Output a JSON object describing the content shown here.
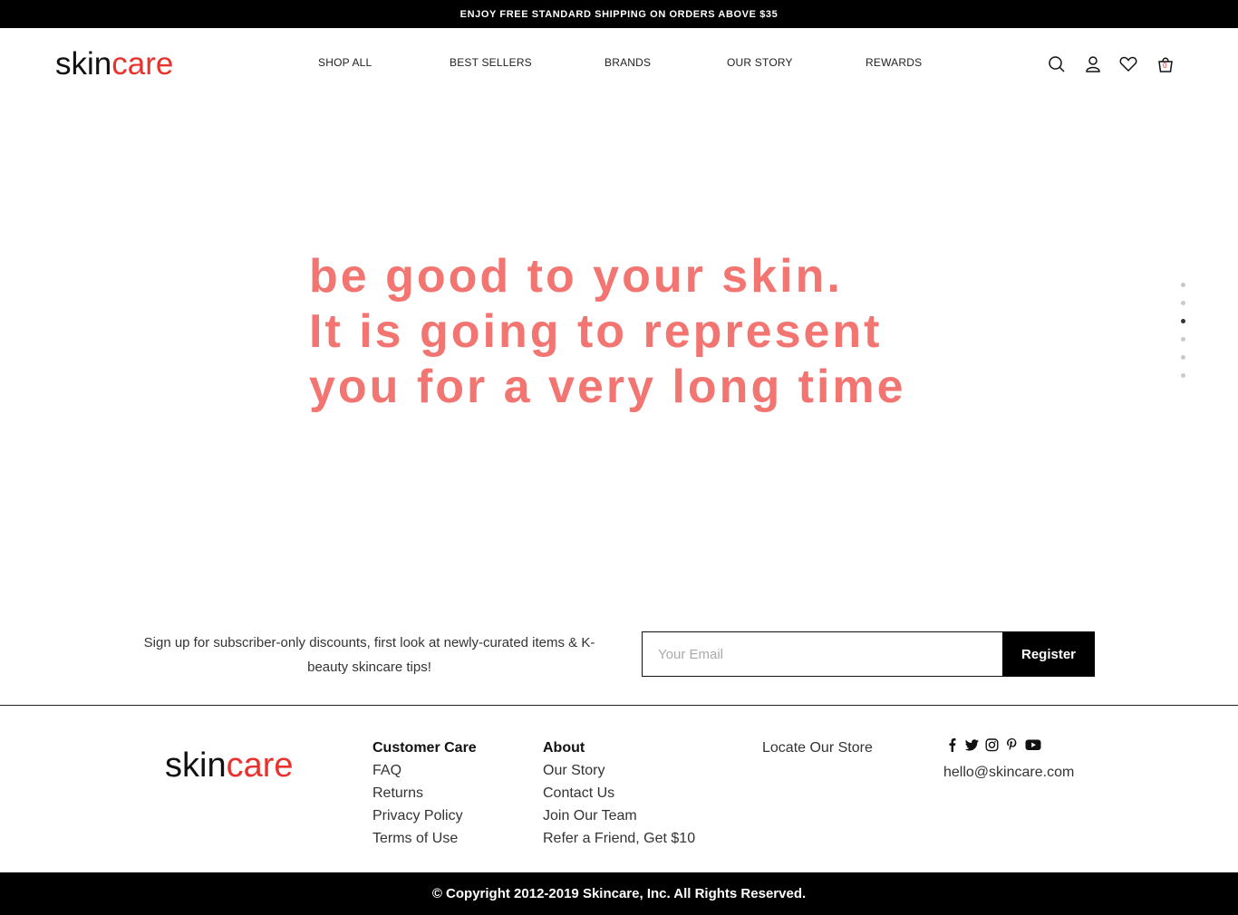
{
  "announcement": "ENJOY FREE STANDARD SHIPPING ON ORDERS ABOVE $35",
  "logo": {
    "part1": "skin",
    "part2": "care",
    "accent_color": "#e8322e"
  },
  "nav": [
    "SHOP ALL",
    "BEST SELLERS",
    "BRANDS",
    "OUR STORY",
    "REWARDS"
  ],
  "header_icons": [
    "search-icon",
    "user-icon",
    "heart-icon",
    "cart-icon"
  ],
  "cart_count": "0",
  "hero": {
    "lines": [
      "be good to your skin.",
      "It is going to represent",
      "you for a very long time"
    ],
    "color": "#f37572"
  },
  "slider": {
    "total": 6,
    "active_index": 2
  },
  "signup": {
    "text": "Sign up for subscriber-only discounts, first look at newly-curated items & K-beauty skincare tips!",
    "placeholder": "Your Email",
    "button": "Register"
  },
  "footer": {
    "customer_care": {
      "heading": "Customer Care",
      "links": [
        "FAQ",
        "Returns",
        "Privacy Policy",
        "Terms of Use"
      ]
    },
    "about": {
      "heading": "About",
      "links": [
        "Our Story",
        "Contact Us",
        "Join Our Team",
        "Refer a Friend, Get $10"
      ]
    },
    "locate": "Locate Our Store",
    "social": [
      "facebook-icon",
      "twitter-icon",
      "instagram-icon",
      "pinterest-icon",
      "youtube-icon"
    ],
    "email": "hello@skincare.com"
  },
  "copyright": "© Copyright 2012-2019 Skincare, Inc. All Rights Reserved."
}
